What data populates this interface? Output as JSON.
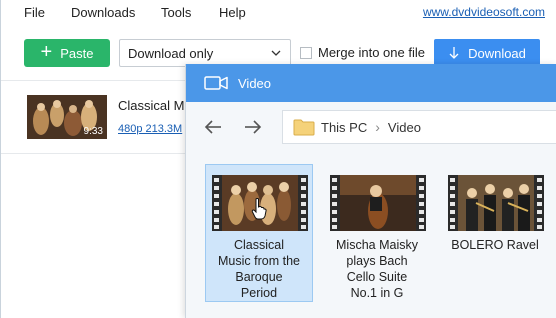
{
  "menu": {
    "items": [
      {
        "label": "File"
      },
      {
        "label": "Downloads"
      },
      {
        "label": "Tools"
      },
      {
        "label": "Help"
      }
    ],
    "site_link": "www.dvdvideosoft.com"
  },
  "toolbar": {
    "paste_label": "Paste",
    "format_selected": "Download only",
    "merge_label": "Merge into one file",
    "merge_checked": false,
    "download_label": "Download"
  },
  "download_item": {
    "title": "Classical M",
    "duration": "9:33",
    "meta": "480p 213.3M"
  },
  "picker": {
    "title": "Video",
    "path": [
      "This PC",
      "Video"
    ],
    "files": [
      {
        "label_lines": [
          "Classical",
          "Music from the",
          "Baroque",
          "Period"
        ],
        "selected": true
      },
      {
        "label_lines": [
          "Mischa Maisky",
          "plays Bach",
          "Cello Suite",
          "No.1 in G"
        ],
        "selected": false
      },
      {
        "label_lines": [
          "BOLERO Ravel"
        ],
        "selected": false
      }
    ]
  },
  "colors": {
    "accent": "#4b97e8",
    "paste_green": "#2ab56a",
    "download_blue": "#3b8ef0",
    "selection": "#cfe5fa",
    "link": "#1a5fb4"
  },
  "icons": {
    "paste": "plus-icon",
    "dropdown": "chevron-down-icon",
    "download": "arrow-down-icon",
    "picker": "video-camera-icon",
    "back": "arrow-left-icon",
    "forward": "arrow-right-icon",
    "folder": "folder-icon",
    "file": "film-strip-icon",
    "pointer": "hand-cursor-icon"
  }
}
